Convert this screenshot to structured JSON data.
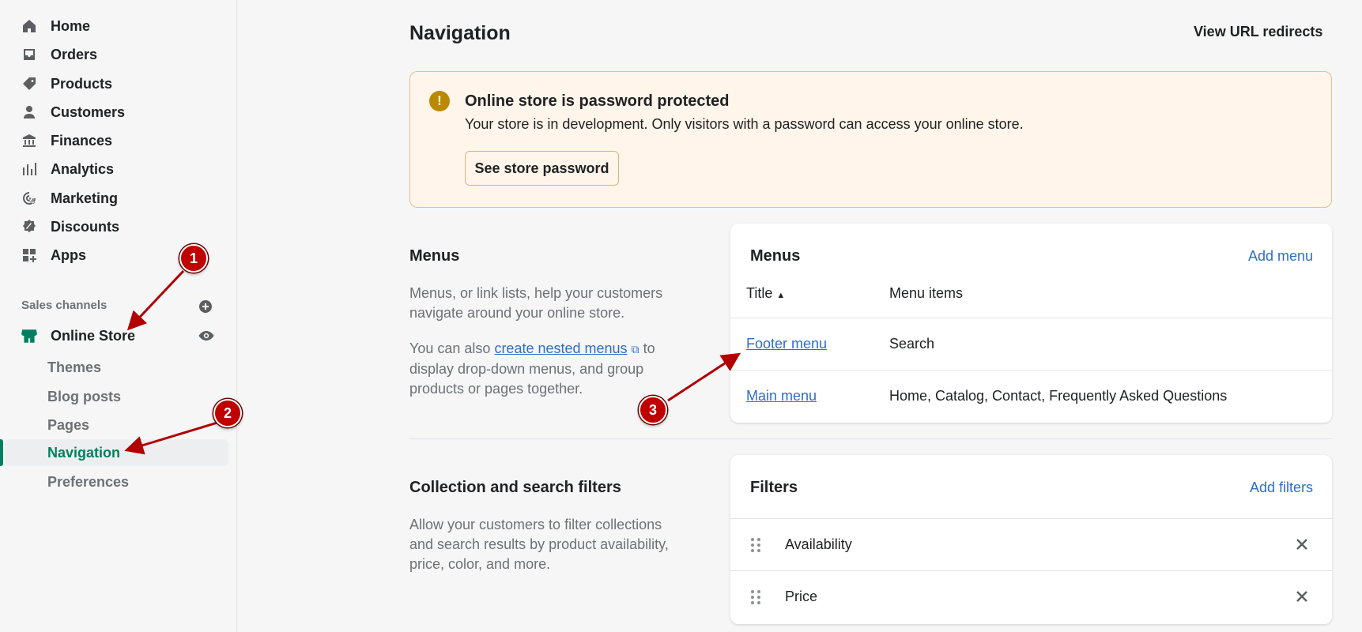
{
  "sidebar": {
    "items": [
      {
        "label": "Home",
        "icon": "home-icon"
      },
      {
        "label": "Orders",
        "icon": "inbox-icon"
      },
      {
        "label": "Products",
        "icon": "tag-icon"
      },
      {
        "label": "Customers",
        "icon": "person-icon"
      },
      {
        "label": "Finances",
        "icon": "bank-icon"
      },
      {
        "label": "Analytics",
        "icon": "bar-chart-icon"
      },
      {
        "label": "Marketing",
        "icon": "target-icon"
      },
      {
        "label": "Discounts",
        "icon": "discount-icon"
      },
      {
        "label": "Apps",
        "icon": "apps-icon"
      }
    ],
    "sales_channels_label": "Sales channels",
    "online_store": {
      "label": "Online Store",
      "icon": "store-icon"
    },
    "sub_items": [
      {
        "label": "Themes"
      },
      {
        "label": "Blog posts"
      },
      {
        "label": "Pages"
      },
      {
        "label": "Navigation",
        "active": true
      },
      {
        "label": "Preferences"
      }
    ]
  },
  "header": {
    "title": "Navigation",
    "redirects_label": "View URL redirects"
  },
  "banner": {
    "title": "Online store is password protected",
    "text": "Your store is in development. Only visitors with a password can access your online store.",
    "button_label": "See store password",
    "icon": "!"
  },
  "menus_section": {
    "title": "Menus",
    "description": "Menus, or link lists, help your customers navigate around your online store.",
    "also_prefix": "You can also",
    "link_text": "create nested menus",
    "also_suffix": "to display drop-down menus, and group products or pages together."
  },
  "menus_card": {
    "title": "Menus",
    "action": "Add menu",
    "col_title": "Title",
    "col_items": "Menu items",
    "rows": [
      {
        "title": "Footer menu",
        "items": "Search"
      },
      {
        "title": "Main menu",
        "items": "Home, Catalog, Contact, Frequently Asked Questions"
      }
    ]
  },
  "filters_section": {
    "title": "Collection and search filters",
    "description": "Allow your customers to filter collections and search results by product availability, price, color, and more."
  },
  "filters_card": {
    "title": "Filters",
    "action": "Add filters",
    "rows": [
      {
        "label": "Availability"
      },
      {
        "label": "Price"
      }
    ]
  },
  "annotations": {
    "m1": "1",
    "m2": "2",
    "m3": "3"
  },
  "colors": {
    "accent": "#008060",
    "link": "#2c6ecb",
    "banner_bg": "#fff5ea",
    "marker": "#c00000"
  }
}
